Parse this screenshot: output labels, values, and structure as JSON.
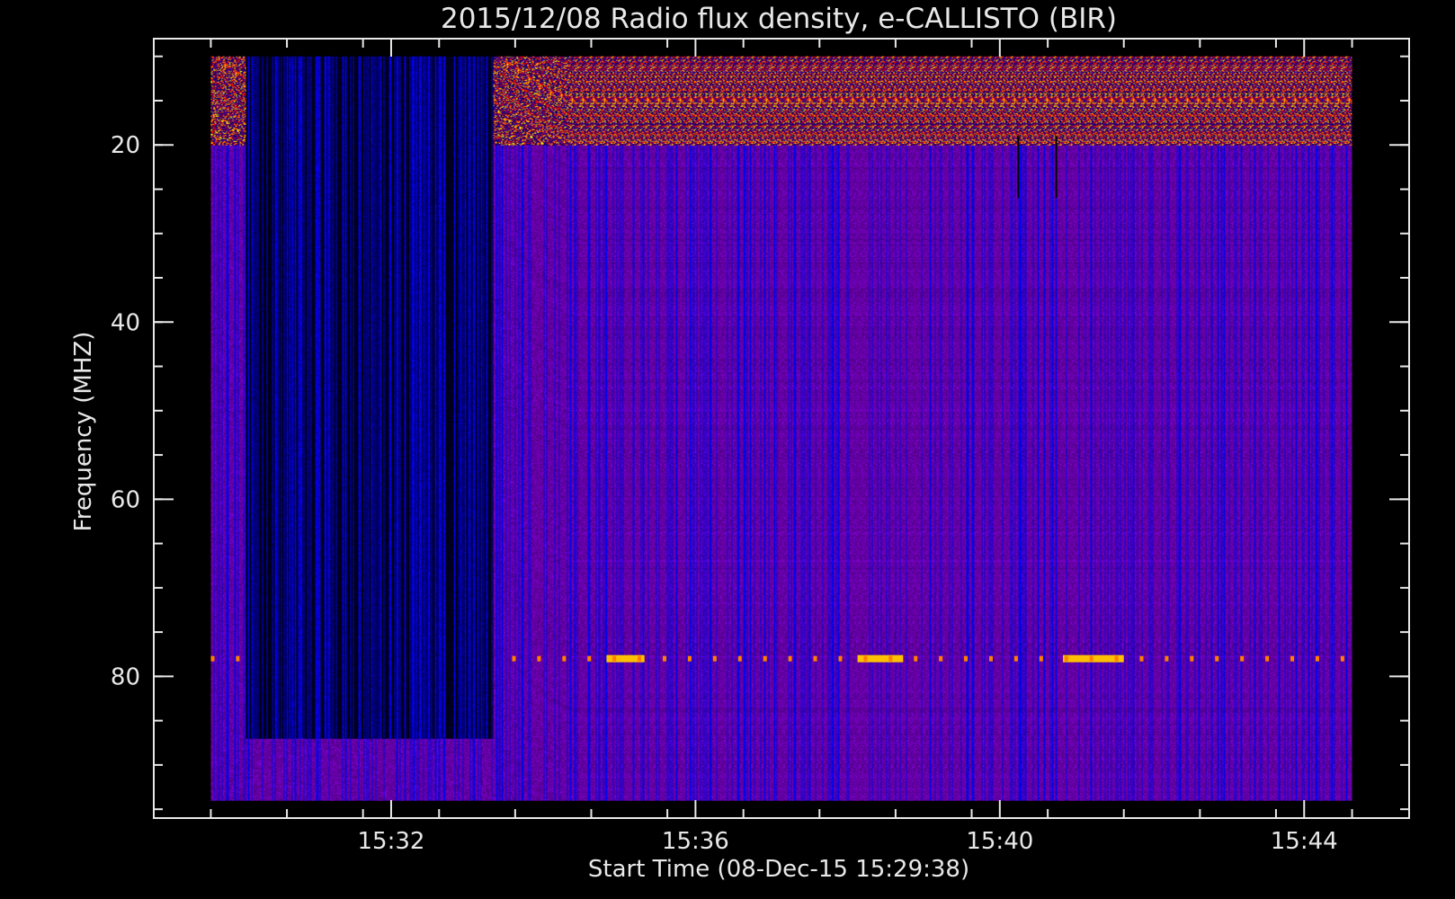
{
  "chart_data": {
    "type": "heatmap",
    "title": "2015/12/08  Radio flux density, e-CALLISTO (BIR)",
    "xlabel": "Start Time (08-Dec-15 15:29:38)",
    "ylabel": "Frequency (MHZ)",
    "x_ticks": [
      "15:32",
      "15:36",
      "15:40",
      "15:44"
    ],
    "x_tick_minutes": [
      2.37,
      6.37,
      10.37,
      14.37
    ],
    "y_ticks": [
      20,
      40,
      60,
      80
    ],
    "y_axis_inverted": true,
    "xlim_minutes": [
      -0.75,
      15.75
    ],
    "ylim_mhz": [
      8,
      96
    ],
    "data_extent": {
      "time_minutes": [
        0,
        15
      ],
      "freq_mhz": [
        10,
        94
      ]
    },
    "colormap": [
      "#000000",
      "#0000ff",
      "#800040",
      "#ff2000",
      "#ffc000"
    ],
    "features": {
      "quiet_interval_minutes": [
        0.45,
        3.7
      ],
      "quiet_freq_cutoff_mhz": 87,
      "interference_band_mhz": [
        10,
        20
      ],
      "persistent_line_mhz": 78,
      "strong_line_segments_minutes": [
        [
          5.2,
          5.7
        ],
        [
          8.5,
          9.1
        ],
        [
          11.2,
          12.0
        ]
      ],
      "dark_spikes_minutes": [
        10.6,
        11.1
      ]
    }
  }
}
